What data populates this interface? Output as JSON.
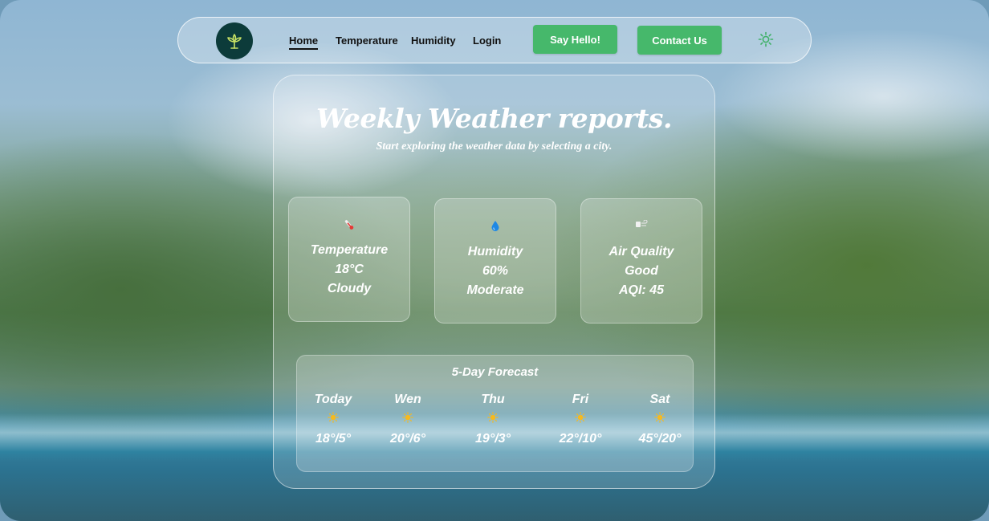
{
  "nav": {
    "links": [
      {
        "label": "Home",
        "active": true
      },
      {
        "label": "Temperature",
        "active": false
      },
      {
        "label": "Humidity",
        "active": false
      },
      {
        "label": "Login",
        "active": false
      }
    ],
    "say_hello": "Say Hello!",
    "contact": "Contact Us",
    "theme_icon": "sun-icon",
    "logo_icon": "plant-icon"
  },
  "hero": {
    "title": "Weekly Weather reports.",
    "subtitle": "Start exploring the weather data by selecting a city."
  },
  "stats": {
    "temperature": {
      "icon": "thermometer-icon",
      "label": "Temperature",
      "value": "18°C",
      "status": "Cloudy"
    },
    "humidity": {
      "icon": "droplet-icon",
      "label": "Humidity",
      "value": "60%",
      "status": "Moderate"
    },
    "air_quality": {
      "icon": "wind-icon",
      "label": "Air Quality",
      "value": "Good",
      "status": "AQI: 45"
    }
  },
  "forecast": {
    "title": "5-Day Forecast",
    "days": [
      {
        "name": "Today",
        "temp": "18°/5°",
        "icon": "sun-icon"
      },
      {
        "name": "Wen",
        "temp": "20°/6°",
        "icon": "sun-icon"
      },
      {
        "name": "Thu",
        "temp": "19°/3°",
        "icon": "sun-icon"
      },
      {
        "name": "Fri",
        "temp": "22°/10°",
        "icon": "sun-icon"
      },
      {
        "name": "Sat",
        "temp": "45°/20°",
        "icon": "sun-icon"
      }
    ]
  },
  "colors": {
    "accent_green": "#46b86b",
    "logo_bg": "#0c3b3a",
    "logo_accent": "#c9e265"
  }
}
